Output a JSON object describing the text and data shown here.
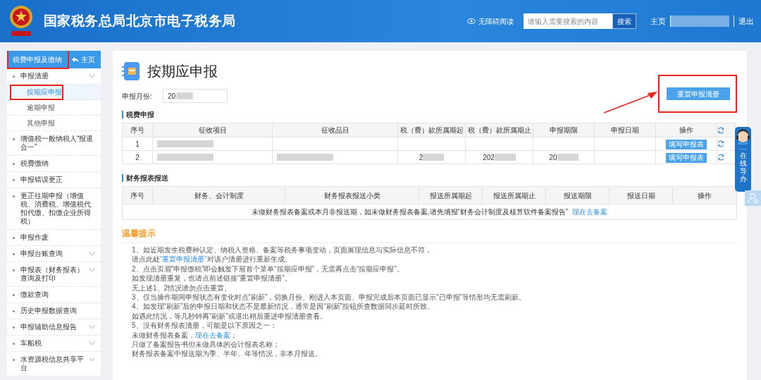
{
  "header": {
    "title": "国家税务总局北京市电子税务局",
    "accessibility": "无障碍阅读",
    "search": {
      "placeholder": "请输入需要搜索的内容",
      "button": "搜索"
    },
    "home": "主页",
    "logout": "退出"
  },
  "sidebar": {
    "title": "税费申报及缴纳",
    "home": "主页",
    "items": [
      {
        "label": "申报清册",
        "expandable": true,
        "children": [
          {
            "label": "按期应申报",
            "selected": true
          },
          {
            "label": "逾期申报",
            "selected": false
          },
          {
            "label": "其他申报",
            "selected": false
          }
        ]
      },
      {
        "label": "增值税一般纳税人“报退合一”",
        "expandable": false
      },
      {
        "label": "税费缴纳",
        "expandable": false
      },
      {
        "label": "申报错误更正",
        "expandable": false
      },
      {
        "label": "更正往期申报（增值税、消费税、增值税代扣代缴、扣缴企业所得税）",
        "expandable": false
      },
      {
        "label": "申报作废",
        "expandable": false
      },
      {
        "label": "申报台账查询",
        "expandable": true
      },
      {
        "label": "申报表（财务报表）查询及打印",
        "expandable": true
      },
      {
        "label": "缴款查询",
        "expandable": false
      },
      {
        "label": "历史申报数据查询",
        "expandable": false
      },
      {
        "label": "申报辅助信息报告",
        "expandable": true
      },
      {
        "label": "车船税",
        "expandable": true
      },
      {
        "label": "水资源税信息共享平台",
        "expandable": true
      }
    ]
  },
  "page": {
    "title": "按期应申报",
    "month_label": "申报月份:",
    "month_value": "20",
    "reset_button": "重置申报清册"
  },
  "tax_table": {
    "title": "税费申报",
    "columns": [
      "序号",
      "征收项目",
      "征收品目",
      "税（费）款所属期起",
      "税（费）款所属期止",
      "申报期限",
      "申报日期",
      "操作"
    ],
    "rows": [
      {
        "cells": [
          {
            "text": "1",
            "redacted": false
          },
          {
            "redacted": true
          },
          {
            "redacted": false
          },
          {
            "redacted": false
          },
          {
            "redacted": false
          },
          {
            "redacted": false
          },
          {
            "redacted": false
          }
        ],
        "action": "填写申报表"
      },
      {
        "cells": [
          {
            "text": "2",
            "redacted": false
          },
          {
            "redacted": true
          },
          {
            "redacted": true
          },
          {
            "text": "2",
            "redacted": true
          },
          {
            "text": "202",
            "redacted": true
          },
          {
            "text": "20",
            "redacted": true
          },
          {
            "redacted": false
          }
        ],
        "action": "填写申报表"
      }
    ]
  },
  "report_table": {
    "title": "财务报表报送",
    "columns": [
      "序号",
      "财务、会计制度",
      "财务报表报送小类",
      "报送所属期起",
      "报送所属期止",
      "报送期限",
      "报送日期",
      "操作"
    ],
    "empty_message": "未做财务报表备案或本月非报送期，如未做财务报表备案,请先填报“财务会计制度及核算软件备案报告”",
    "empty_link": "现在去备案"
  },
  "tips": {
    "title": "温馨提示",
    "lines": [
      [
        {
          "text": "1、如近期发生税费种认定、纳税人资格、备案等税务事项变动，页面展现信息与实际信息不符，",
          "link": false
        }
      ],
      [
        {
          "text": "请点此处",
          "link": false
        },
        {
          "text": "“重置申报清册”",
          "link": true
        },
        {
          "text": "对该户清册进行重新生成。",
          "link": false
        }
      ],
      [
        {
          "text": "2、点击页眉“申报缴税”即会触发下屉首个菜单“按期应申报”，无需再点击“按期应申报”。",
          "link": false
        }
      ],
      [
        {
          "text": "如发现清册重复，也请点前述链接“重置申报清册”。",
          "link": false
        }
      ],
      [
        {
          "text": "无上述1、2情况请勿点击重置。",
          "link": false
        }
      ],
      [
        {
          "text": "3、仅当操作期间申报状态有变化时点“刷新”，切换月份、刚进入本页面、申报完成后本页面已显示“已申报”等情形均无需刷新。",
          "link": false
        }
      ],
      [
        {
          "text": "4、如发现“刷新”后的申报日期和状态不是最新情况，通常是因“刷新”按钮所查数据同步延时所致。",
          "link": false
        }
      ],
      [
        {
          "text": "如遇此情况，等几秒钟再“刷新”或退出稍后重进申报清册查看。",
          "link": false
        }
      ],
      [
        {
          "text": "5、没有财务报表清册，可能是以下原因之一：",
          "link": false
        }
      ],
      [
        {
          "text": "未做财务报表备案，",
          "link": false
        },
        {
          "text": "现在去备案",
          "link": true
        },
        {
          "text": "；",
          "link": false
        }
      ],
      [
        {
          "text": "只做了备案报告书但未做具体的会计报表名称；",
          "link": false
        }
      ],
      [
        {
          "text": "财务报表备案中报送期为季、半年、年等情况，非本月报送。",
          "link": false
        }
      ]
    ]
  },
  "helper": {
    "label": "在线导办"
  }
}
